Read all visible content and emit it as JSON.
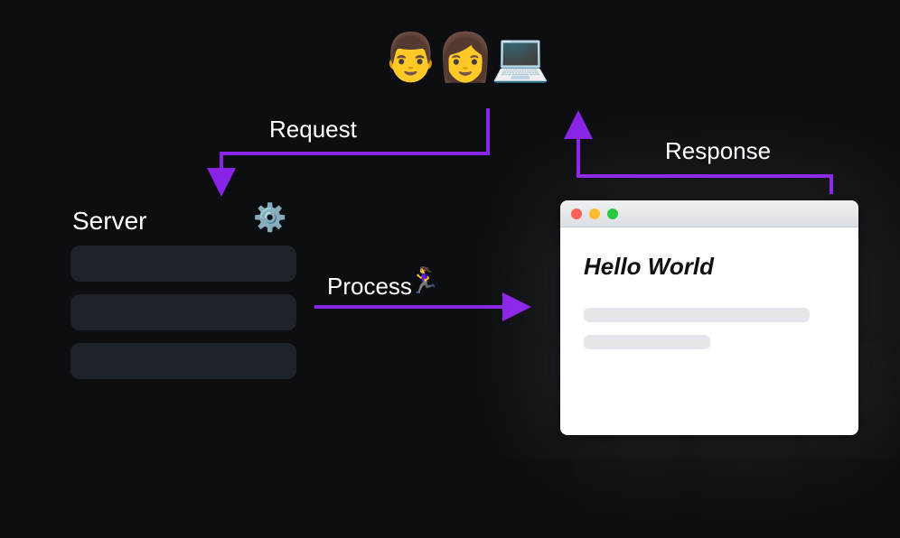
{
  "users": {
    "icons": [
      "man-icon",
      "woman-icon",
      "laptop-icon"
    ],
    "glyphs": "👨👩💻"
  },
  "labels": {
    "request": "Request",
    "response": "Response",
    "process": "Process",
    "server": "Server"
  },
  "server": {
    "gear_icon": "gear-icon",
    "row_count": 3
  },
  "process": {
    "runner_icon": "runner-icon",
    "runner_glyph": "🏃‍♀️"
  },
  "browser": {
    "traffic_lights": [
      "red",
      "yellow",
      "green"
    ],
    "heading": "Hello World",
    "placeholder_lines": 2
  },
  "colors": {
    "arrow": "#8924e6",
    "background": "#0c0e11",
    "server_row": "#1e232a"
  }
}
